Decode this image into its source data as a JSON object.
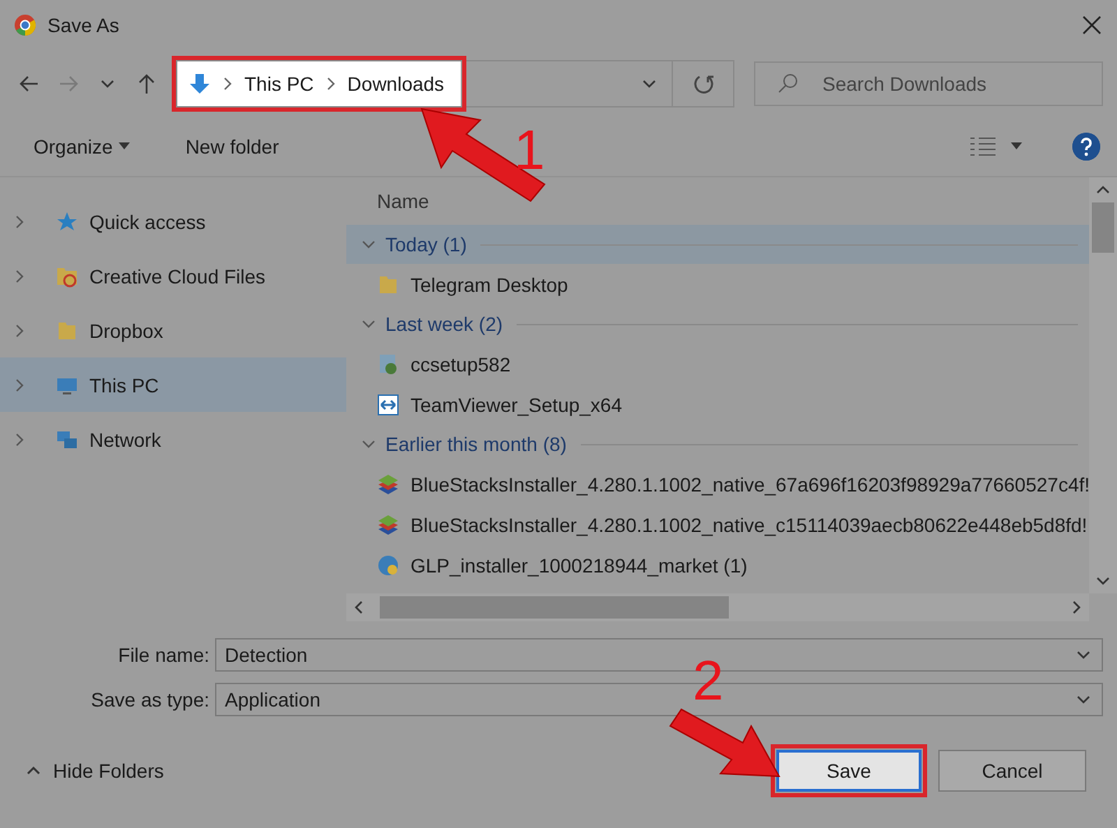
{
  "window": {
    "title": "Save As"
  },
  "address_bar": {
    "breadcrumb": [
      "This PC",
      "Downloads"
    ],
    "highlighted": true
  },
  "search": {
    "placeholder": "Search Downloads"
  },
  "toolbar": {
    "organize": "Organize",
    "new_folder": "New folder"
  },
  "sidebar": {
    "items": [
      {
        "label": "Quick access",
        "kind": "star",
        "selected": false
      },
      {
        "label": "Creative Cloud Files",
        "kind": "cloud-folder",
        "selected": false
      },
      {
        "label": "Dropbox",
        "kind": "folder",
        "selected": false
      },
      {
        "label": "This PC",
        "kind": "pc",
        "selected": true
      },
      {
        "label": "Network",
        "kind": "network",
        "selected": false
      }
    ]
  },
  "file_list": {
    "column": "Name",
    "groups": [
      {
        "label": "Today (1)",
        "selected": true,
        "items": [
          {
            "name": "Telegram Desktop",
            "kind": "folder"
          }
        ]
      },
      {
        "label": "Last week (2)",
        "selected": false,
        "items": [
          {
            "name": "ccsetup582",
            "kind": "installer"
          },
          {
            "name": "TeamViewer_Setup_x64",
            "kind": "remote"
          }
        ]
      },
      {
        "label": "Earlier this month (8)",
        "selected": false,
        "items": [
          {
            "name": "BlueStacksInstaller_4.280.1.1002_native_67a696f16203f98929a77660527c4f!",
            "kind": "stack"
          },
          {
            "name": "BlueStacksInstaller_4.280.1.1002_native_c15114039aecb80622e448eb5d8fd!",
            "kind": "stack"
          },
          {
            "name": "GLP_installer_1000218944_market (1)",
            "kind": "globe"
          }
        ]
      }
    ]
  },
  "fields": [
    {
      "label": "File name:",
      "value": "Detection"
    },
    {
      "label": "Save as type:",
      "value": "Application"
    }
  ],
  "hide_folders": "Hide Folders",
  "buttons": [
    {
      "label": "Save",
      "highlighted": true
    },
    {
      "label": "Cancel",
      "highlighted": false
    }
  ],
  "annotations": [
    {
      "label": "1"
    },
    {
      "label": "2"
    }
  ]
}
